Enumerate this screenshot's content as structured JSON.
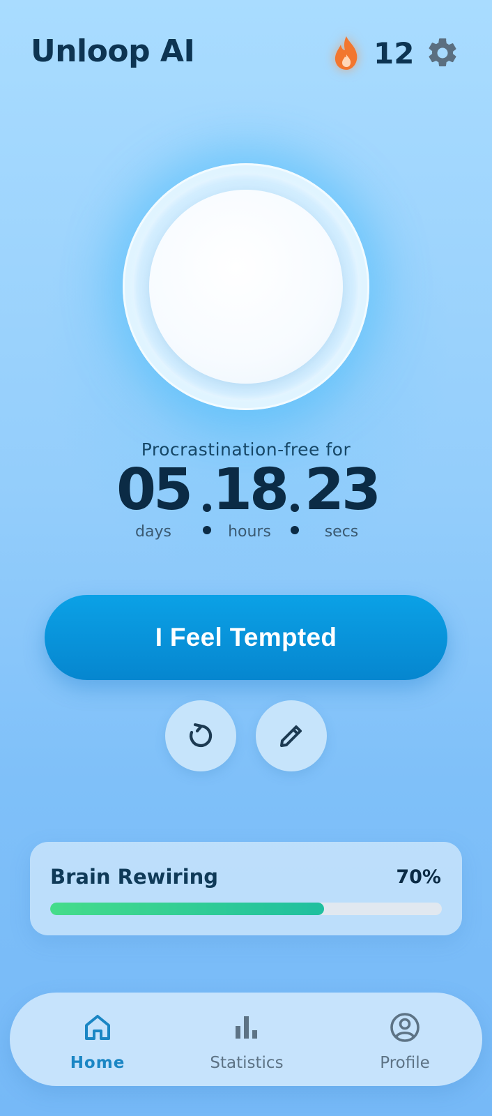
{
  "header": {
    "title": "Unloop AI",
    "streak_count": "12",
    "streak_icon": "flame-icon",
    "settings_icon": "gear-icon"
  },
  "timer": {
    "caption": "Procrastination-free for",
    "days": "05",
    "days_label": "days",
    "hours": "18",
    "hours_label": "hours",
    "secs": "23",
    "secs_label": "secs"
  },
  "actions": {
    "tempted_label": "I Feel Tempted",
    "reset_icon": "reset-icon",
    "edit_icon": "pencil-icon"
  },
  "progress": {
    "title": "Brain Rewiring",
    "percent_label": "70%",
    "value": 0.7
  },
  "nav": {
    "items": [
      {
        "label": "Home",
        "icon": "home-icon",
        "active": true
      },
      {
        "label": "Statistics",
        "icon": "bar-chart-icon",
        "active": false
      },
      {
        "label": "Profile",
        "icon": "profile-icon",
        "active": false
      }
    ]
  },
  "colors": {
    "accent": "#0a97dd",
    "progress_start": "#45dc8a",
    "progress_end": "#1fbf9f",
    "flame": "#f2762e"
  }
}
